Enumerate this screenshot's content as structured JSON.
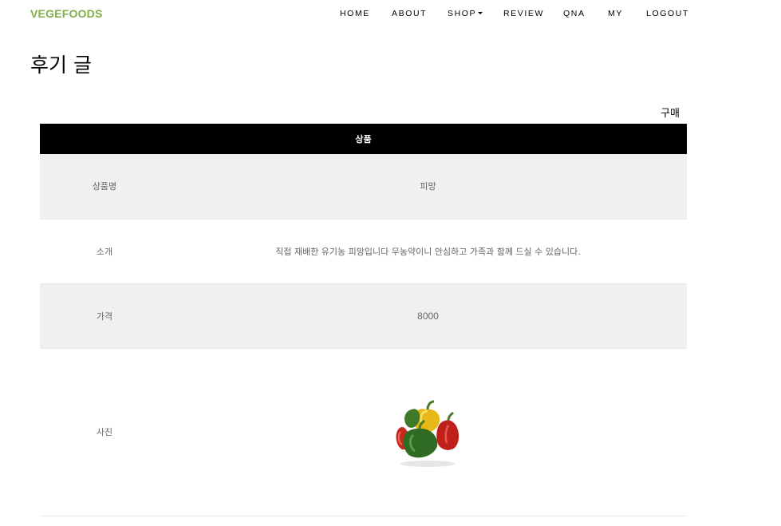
{
  "navbar": {
    "brand": "VEGEFOODS",
    "items": [
      {
        "label": "HOME"
      },
      {
        "label": "ABOUT"
      },
      {
        "label": "SHOP",
        "dropdown": true
      },
      {
        "label": "REVIEW"
      },
      {
        "label": "QNA"
      },
      {
        "label": "MY"
      },
      {
        "label": "LOGOUT"
      }
    ]
  },
  "page": {
    "title": "후기 글",
    "buy_link": "구매"
  },
  "product_table": {
    "header": "상품",
    "rows": [
      {
        "label": "상품명",
        "value": "피망"
      },
      {
        "label": "소개",
        "value": "직접 재배한 유기농 피망입니다 무농약이니 안심하고 가족과 함께 드실 수 있습니다."
      },
      {
        "label": "가격",
        "value": "8000"
      },
      {
        "label": "사진",
        "image": "bell-peppers-photo"
      }
    ]
  },
  "colors": {
    "brand": "#82ae46",
    "table_header_bg": "#000000",
    "shaded_row_bg": "#f0f0f0"
  }
}
